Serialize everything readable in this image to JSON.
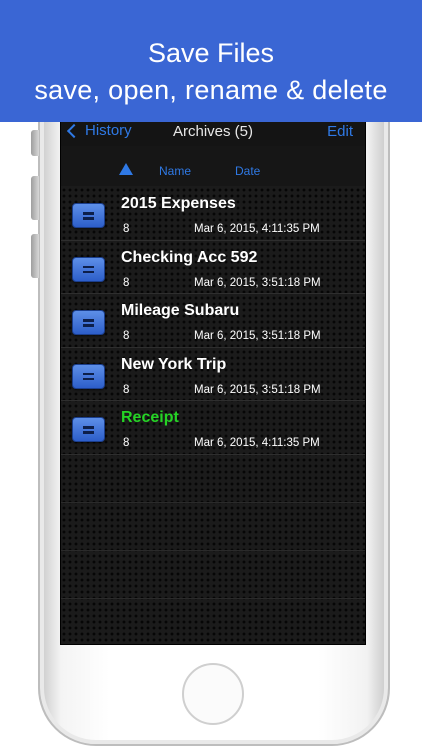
{
  "banner": {
    "title": "Save Files",
    "subtitle": "save, open, rename & delete"
  },
  "navbar": {
    "back_label": "History",
    "title": "Archives (5)",
    "edit_label": "Edit"
  },
  "sort": {
    "name_label": "Name",
    "date_label": "Date"
  },
  "files": [
    {
      "name": "2015 Expenses",
      "size": "8",
      "date": "Mar 6, 2015, 4:11:35 PM"
    },
    {
      "name": "Checking Acc 592",
      "size": "8",
      "date": "Mar 6, 2015, 3:51:18 PM"
    },
    {
      "name": "Mileage Subaru",
      "size": "8",
      "date": "Mar 6, 2015, 3:51:18 PM"
    },
    {
      "name": "New York Trip",
      "size": "8",
      "date": "Mar 6, 2015, 3:51:18 PM"
    },
    {
      "name": "Receipt",
      "size": "8",
      "date": "Mar 6, 2015, 4:11:35 PM"
    }
  ],
  "colors": {
    "accent": "#2f79e5",
    "banner": "#3a66d4",
    "highlight_name": "#25d325"
  },
  "icons": {
    "back": "chevron-left-icon",
    "sort": "triangle-up-icon",
    "file": "file-icon"
  }
}
